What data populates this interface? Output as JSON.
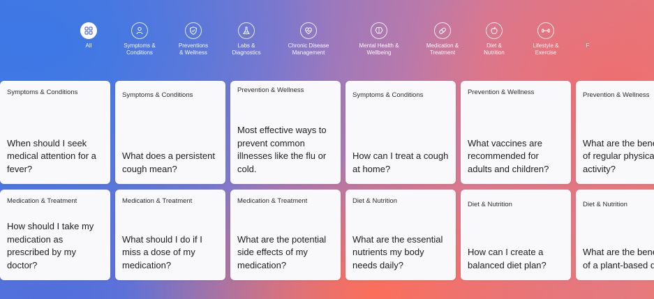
{
  "nav": {
    "items": [
      {
        "label": "All",
        "icon": "grid-icon",
        "active": true
      },
      {
        "label": "Symptoms &\nConditions",
        "icon": "person-symptoms-icon"
      },
      {
        "label": "Preventions\n& Wellness",
        "icon": "shield-wellness-icon"
      },
      {
        "label": "Labs &\nDiagnostics",
        "icon": "flask-icon"
      },
      {
        "label": "Chronic Disease\nManagement",
        "icon": "heart-monitor-icon"
      },
      {
        "label": "Mental Health &\nWellbeing",
        "icon": "brain-icon"
      },
      {
        "label": "Medication &\nTreatment",
        "icon": "pill-icon"
      },
      {
        "label": "Diet &\nNutrition",
        "icon": "apple-icon"
      },
      {
        "label": "Lifestyle &\nExercise",
        "icon": "dumbbell-icon"
      },
      {
        "label": "F",
        "icon": ""
      }
    ]
  },
  "cards": {
    "row1": [
      {
        "category": "Symptoms & Conditions",
        "question": "When should I seek medical attention for a fever?"
      },
      {
        "category": "Symptoms & Conditions",
        "question": "What does a persistent cough mean?"
      },
      {
        "category": "Prevention & Wellness",
        "question": "Most effective ways to prevent common illnesses like the flu or cold."
      },
      {
        "category": "Symptoms & Conditions",
        "question": "How can I treat a cough at home?"
      },
      {
        "category": "Prevention & Wellness",
        "question": "What vaccines are recommended for adults and children?"
      },
      {
        "category": "Prevention & Wellness",
        "question": "What are the benefits of regular physical activity?"
      }
    ],
    "row2": [
      {
        "category": "Medication & Treatment",
        "question": "How should I take my medication as prescribed by my doctor?"
      },
      {
        "category": "Medication & Treatment",
        "question": "What should I do if I miss a dose of my medication?"
      },
      {
        "category": "Medication & Treatment",
        "question": "What are the potential side effects of my medication?"
      },
      {
        "category": "Diet & Nutrition",
        "question": "What are the essential nutrients my body needs daily?"
      },
      {
        "category": "Diet & Nutrition",
        "question": "How can I create a balanced diet plan?"
      },
      {
        "category": "Diet & Nutrition",
        "question": "What are the benefits of a plant-based diet?"
      }
    ]
  }
}
